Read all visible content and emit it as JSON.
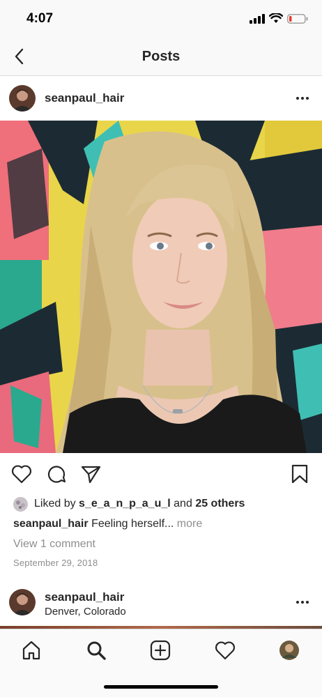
{
  "status_bar": {
    "time": "4:07"
  },
  "nav": {
    "title": "Posts",
    "back_icon": "chevron-left-icon"
  },
  "post": {
    "username": "seanpaul_hair",
    "likes": {
      "prefix": "Liked by",
      "first_liker": "s_e_a_n_p_a_u_l",
      "conjunction": "and",
      "others": "25 others"
    },
    "caption": {
      "username": "seanpaul_hair",
      "text": "Feeling herself...",
      "more_label": "more"
    },
    "view_comments": "View 1 comment",
    "date": "September 29, 2018",
    "actions": [
      "heart-icon",
      "comment-icon",
      "share-icon",
      "bookmark-icon"
    ]
  },
  "next_post": {
    "username": "seanpaul_hair",
    "location": "Denver, Colorado"
  },
  "tab_bar": {
    "tabs": [
      "home-icon",
      "search-icon",
      "add-post-icon",
      "activity-heart-icon",
      "profile-avatar"
    ]
  },
  "colors": {
    "text": "#262626",
    "secondary_text": "#8e8e8e",
    "divider": "#dbdbdb",
    "battery_low": "#e33b2f"
  }
}
